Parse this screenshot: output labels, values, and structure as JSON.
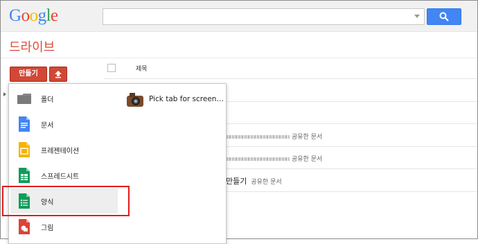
{
  "header": {
    "logo_letters": [
      "G",
      "o",
      "o",
      "g",
      "l",
      "e"
    ],
    "logo_colors": [
      "#4285f4",
      "#ea4335",
      "#fbbc05",
      "#4285f4",
      "#34a853",
      "#ea4335"
    ],
    "search_value": "",
    "search_icon": "search-icon"
  },
  "drive": {
    "title": "드라이브"
  },
  "toolbar": {
    "create_label": "만들기",
    "upload_icon": "upload-icon"
  },
  "list": {
    "title_column": "제목",
    "rows": [
      {
        "title": "",
        "shared": "공유한 문서"
      },
      {
        "title": "",
        "shared": "공유한 문서"
      },
      {
        "title": "만들기",
        "shared": "공유한 문서"
      }
    ]
  },
  "menu": {
    "items": [
      {
        "label": "폴더",
        "icon": "folder-icon"
      },
      {
        "label": "문서",
        "icon": "document-icon"
      },
      {
        "label": "프레젠테이션",
        "icon": "presentation-icon"
      },
      {
        "label": "스프레드시트",
        "icon": "spreadsheet-icon"
      },
      {
        "label": "양식",
        "icon": "form-icon"
      },
      {
        "label": "그림",
        "icon": "drawing-icon"
      }
    ],
    "app": {
      "label": "Pick tab for screen…",
      "icon": "camera-icon"
    }
  },
  "colors": {
    "accent_red": "#d14836",
    "drive_title": "#dd4b39",
    "search_blue": "#4285f4",
    "highlight": "#e21b1b"
  }
}
